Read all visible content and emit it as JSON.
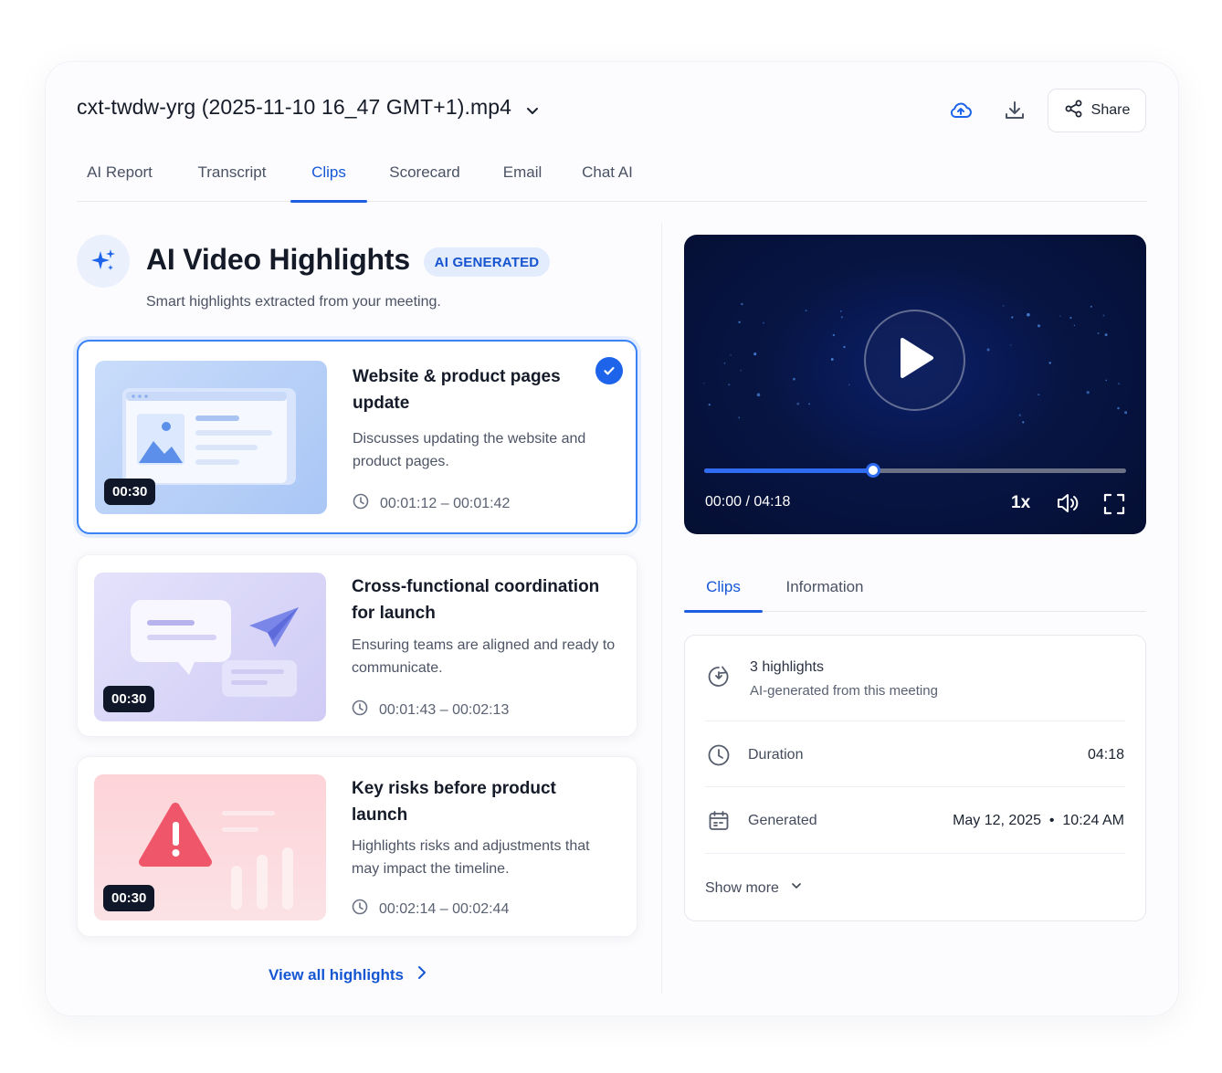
{
  "header": {
    "file_name": "cxt-twdw-yrg (2025-11-10 16_47 GMT+1).mp4",
    "share_label": "Share"
  },
  "tabs": [
    {
      "label": "AI Report",
      "active": false
    },
    {
      "label": "Transcript",
      "active": false
    },
    {
      "label": "Clips",
      "active": true
    },
    {
      "label": "Scorecard",
      "active": false
    },
    {
      "label": "Email",
      "active": false
    },
    {
      "label": "Chat AI",
      "active": false
    }
  ],
  "highlights": {
    "title": "AI Video Highlights",
    "badge": "AI GENERATED",
    "subtitle": "Smart highlights extracted from your meeting.",
    "view_all": "View all highlights",
    "clips": [
      {
        "duration": "00:30",
        "title": "Website & product pages update",
        "description": "Discusses updating the website and product pages.",
        "time_range": "00:01:12 – 00:01:42",
        "selected": true
      },
      {
        "duration": "00:30",
        "title": "Cross-functional coordination for launch",
        "description": "Ensuring teams are aligned and ready to communicate.",
        "time_range": "00:01:43 – 00:02:13",
        "selected": false
      },
      {
        "duration": "00:30",
        "title": "Key risks before product launch",
        "description": "Highlights risks and adjustments that may impact the timeline.",
        "time_range": "00:02:14 – 00:02:44",
        "selected": false
      }
    ]
  },
  "player": {
    "time_display": "00:00 / 04:18",
    "speed": "1x",
    "progress_fraction": 0.4
  },
  "right_tabs": [
    {
      "label": "Clips",
      "active": true
    },
    {
      "label": "Information",
      "active": false
    }
  ],
  "info": {
    "highlights_count": "3 highlights",
    "highlights_sub": "AI-generated from this meeting",
    "duration_label": "Duration",
    "duration_value": "04:18",
    "generated_label": "Generated",
    "generated_value": "May 12, 2025  •  10:24 AM",
    "show_more": "Show more"
  },
  "colors": {
    "accent": "#1d5fe0",
    "player_bg": "#071544",
    "alert_red": "#f0566a"
  }
}
